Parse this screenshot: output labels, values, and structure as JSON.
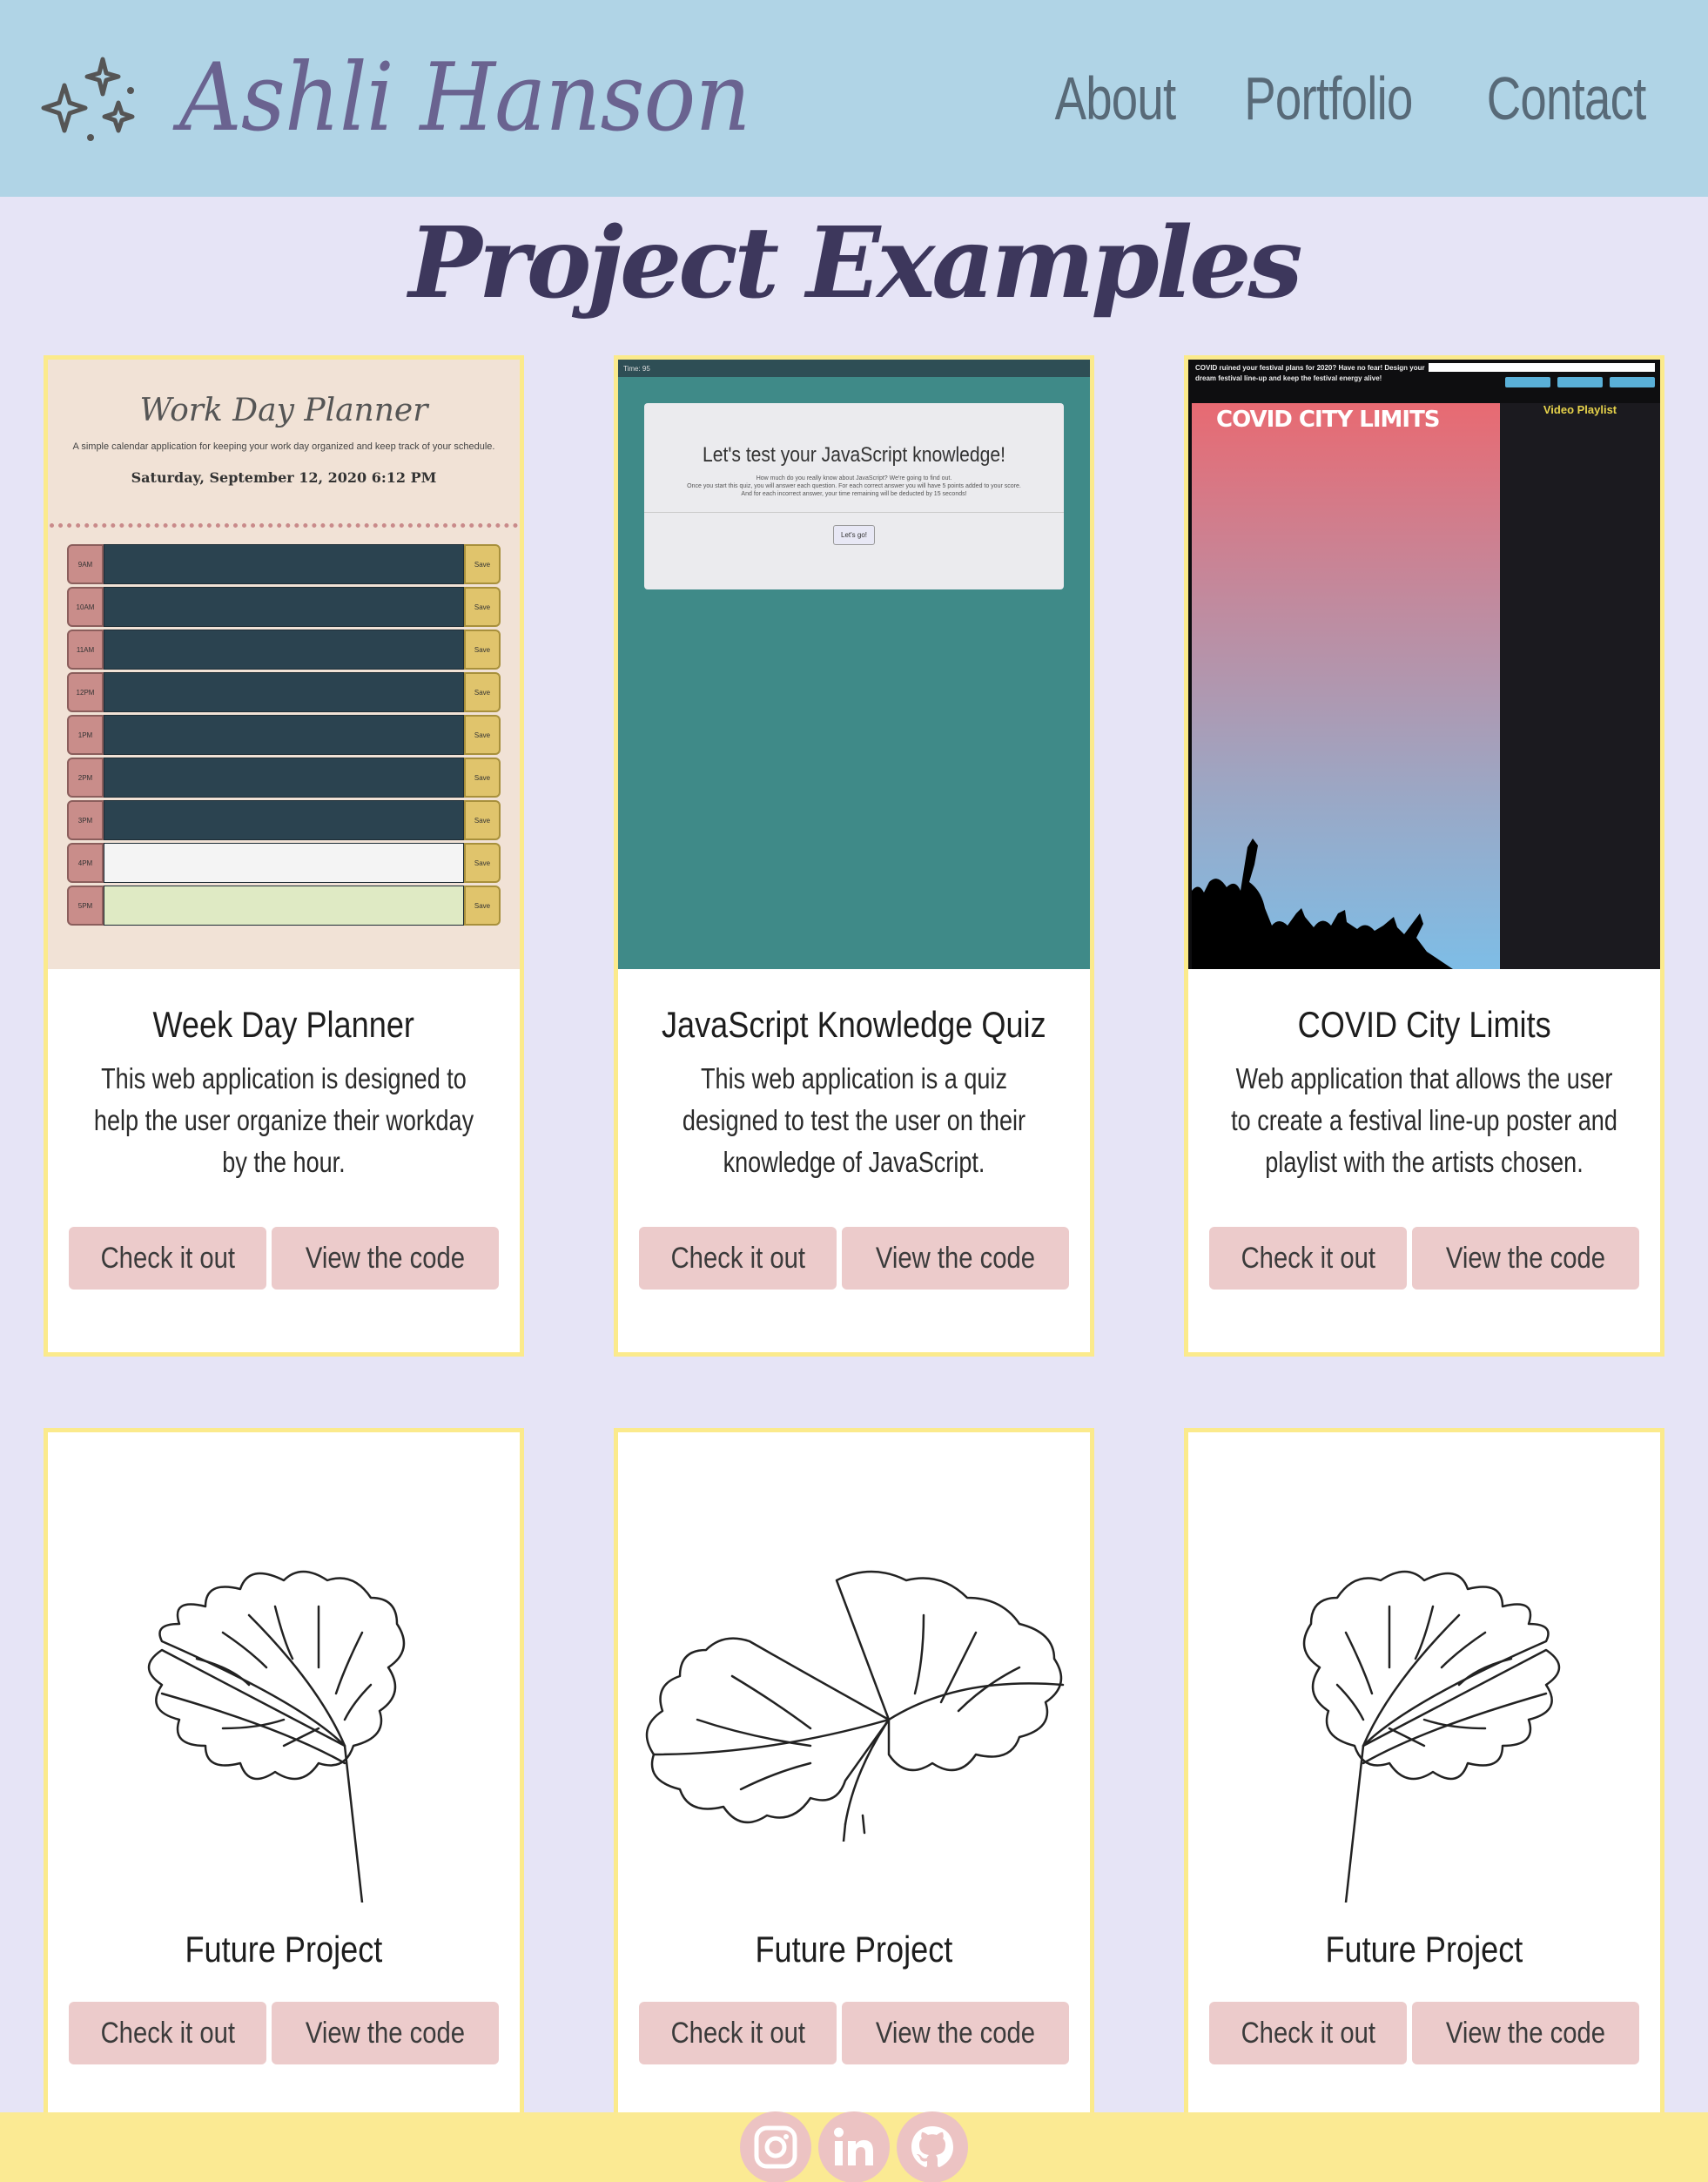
{
  "header": {
    "brand_name": "Ashli Hanson",
    "logo_icon": "sparkles-icon",
    "nav": [
      "About",
      "Portfolio",
      "Contact"
    ]
  },
  "page_title": "Project Examples",
  "buttons": {
    "check": "Check it out",
    "code": "View the code"
  },
  "projects": [
    {
      "title": "Week Day Planner",
      "description": "This web application is designed to help the user organize their workday by the hour.",
      "screenshot": {
        "app_title": "Work Day Planner",
        "subtitle": "A simple calendar application for keeping your work day organized and keep track of your schedule.",
        "date": "Saturday, September 12, 2020 6:12 PM",
        "hours": [
          "9AM",
          "10AM",
          "11AM",
          "12PM",
          "1PM",
          "2PM",
          "3PM",
          "4PM",
          "5PM"
        ],
        "save_label": "Save"
      }
    },
    {
      "title": "JavaScript Knowledge Quiz",
      "description": "This web application is a quiz designed to test the user on their knowledge of JavaScript.",
      "screenshot": {
        "timer": "Time: 95",
        "heading": "Let's test your JavaScript knowledge!",
        "line1": "How much do you really know about JavaScript? We're going to find out.",
        "line2": "Once you start this quiz, you will answer each question. For each correct answer you will have 5 points added to your score.",
        "line3": "And for each incorrect answer, your time remaining will be deducted by 15 seconds!",
        "button": "Let's go!"
      }
    },
    {
      "title": "COVID City Limits",
      "description": "Web application that allows the user to create a festival line-up poster and playlist with the artists chosen.",
      "screenshot": {
        "intro": "COVID ruined your festival plans for 2020? Have no fear! Design your dream festival line-up and keep the festival energy alive!",
        "poster_title": "COVID CITY LIMITS",
        "playlist_label": "Video Playlist"
      }
    },
    {
      "title": "Future Project",
      "image": "single-monstera-leaf"
    },
    {
      "title": "Future Project",
      "image": "double-monstera-leaf"
    },
    {
      "title": "Future Project",
      "image": "single-monstera-leaf"
    }
  ],
  "footer": {
    "icons": [
      "instagram-icon",
      "linkedin-icon",
      "github-icon"
    ]
  },
  "colors": {
    "header_bg": "#b0d4e6",
    "page_bg": "#e6e4f6",
    "card_border": "#fbea8c",
    "button_bg": "#eccbcb",
    "footer_bg": "#fbea93"
  }
}
